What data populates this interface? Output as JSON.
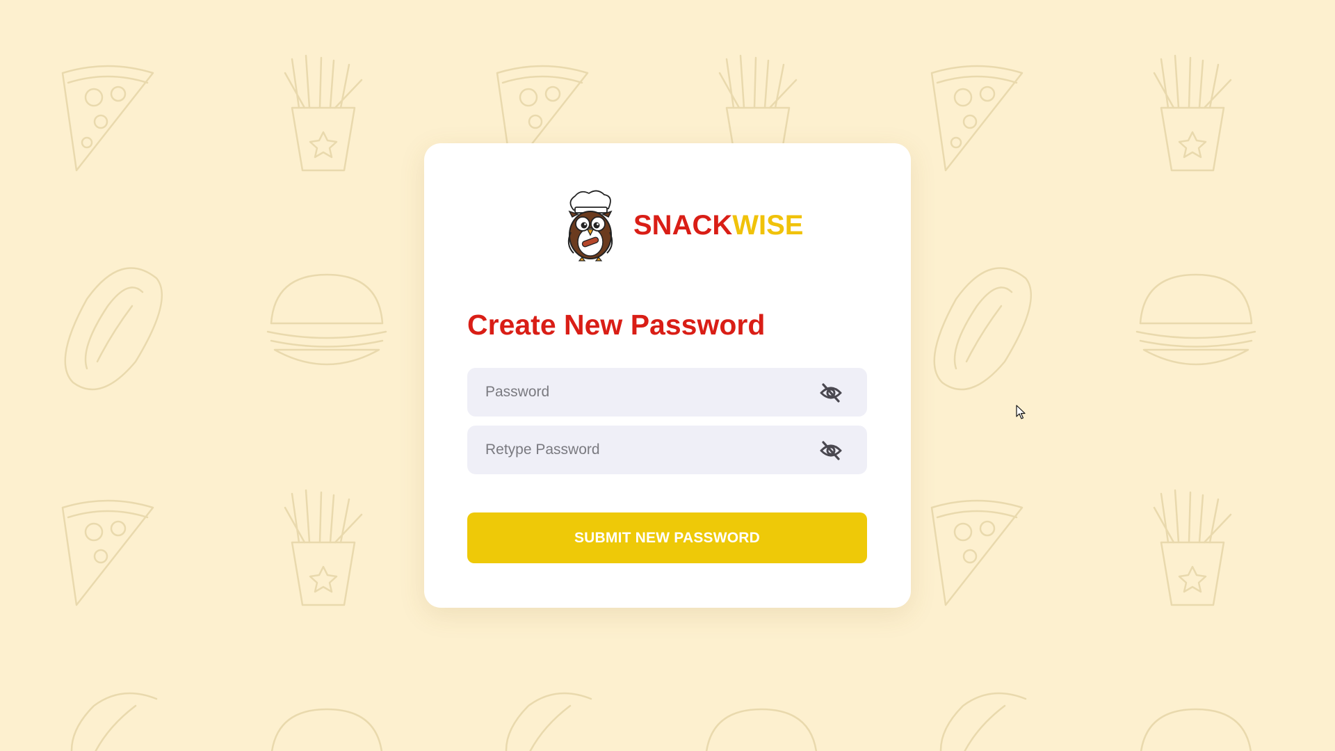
{
  "brand": {
    "name_part1": "SNACK",
    "name_part2": "WISE",
    "logo_icon": "chef-owl-icon",
    "colors": {
      "red": "#d91e16",
      "yellow": "#f0c20a"
    }
  },
  "page": {
    "title": "Create New Password",
    "background_color": "#fdf0cf"
  },
  "form": {
    "password": {
      "placeholder": "Password",
      "value": "",
      "toggle_icon": "eye-slash-icon"
    },
    "retype_password": {
      "placeholder": "Retype Password",
      "value": "",
      "toggle_icon": "eye-slash-icon"
    },
    "submit_label": "SUBMIT NEW PASSWORD",
    "submit_color": "#eec908"
  },
  "background": {
    "doodle_icons": [
      "pizza-slice-icon",
      "fries-icon",
      "hotdog-icon",
      "burger-icon"
    ]
  }
}
